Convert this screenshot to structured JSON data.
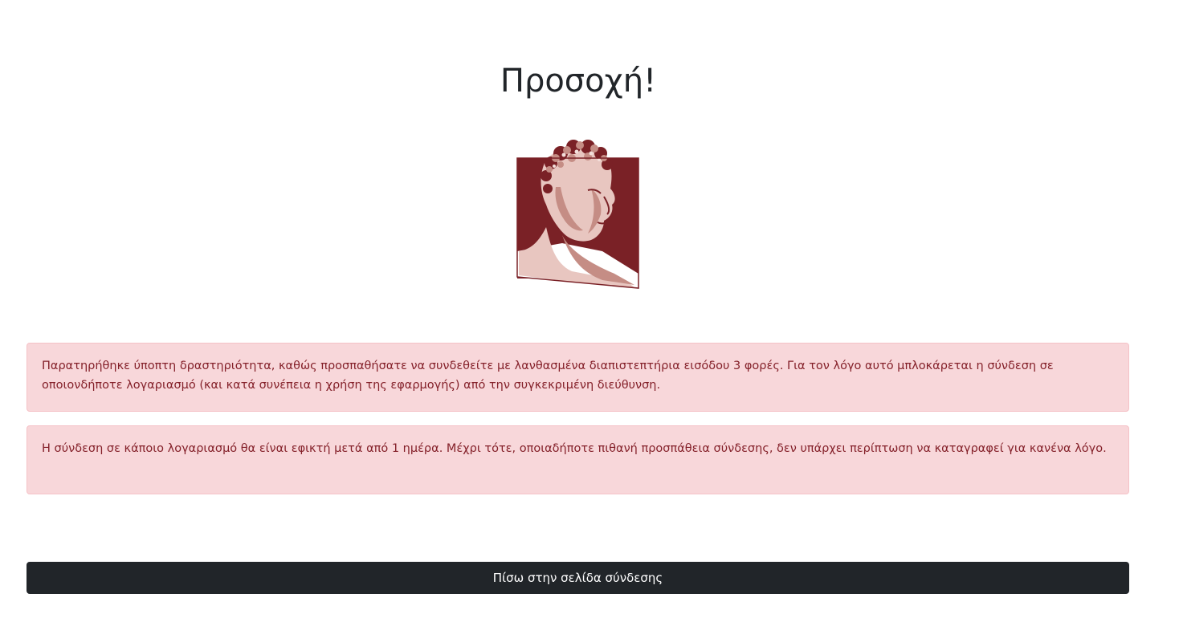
{
  "header": {
    "title": "Προσοχή!"
  },
  "logo": {
    "icon": "university-logo-hermes-head",
    "colors": {
      "primary": "#7a2126",
      "light": "#e8c6c0",
      "mid": "#c58d85"
    }
  },
  "alerts": [
    {
      "text": "Παρατηρήθηκε ύποπτη δραστηριότητα, καθώς προσπαθήσατε να συνδεθείτε με λανθασμένα διαπιστεπτήρια εισόδου 3 φορές. Για τον λόγο αυτό μπλοκάρεται η σύνδεση σε οποιονδήποτε λογαριασμό (και κατά συνέπεια η χρήση της εφαρμογής) από την συγκεκριμένη διεύθυνση."
    },
    {
      "text": "Η σύνδεση σε κάποιο λογαριασμό θα είναι εφικτή μετά από 1 ημέρα. Μέχρι τότε, οποιαδήποτε πιθανή προσπάθεια σύνδεσης, δεν υπάρχει περίπτωση να καταγραφεί για κανένα λόγο."
    }
  ],
  "actions": {
    "back_label": "Πίσω στην σελίδα σύνδεσης"
  },
  "theme": {
    "alert_bg": "#f8d7da",
    "alert_text": "#842029",
    "button_bg": "#212529",
    "button_text": "#ffffff"
  }
}
